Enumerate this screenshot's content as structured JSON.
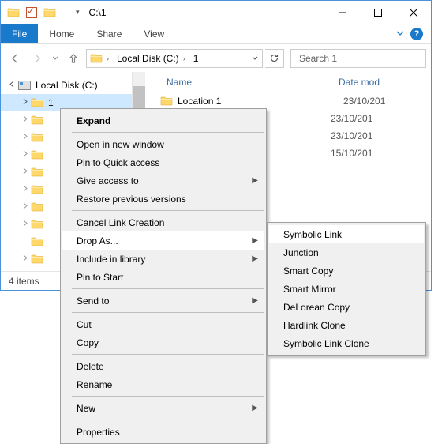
{
  "window": {
    "title": "C:\\1"
  },
  "ribbon": {
    "file": "File",
    "tabs": [
      "Home",
      "Share",
      "View"
    ]
  },
  "address": {
    "seg1": "Local Disk (C:)",
    "seg2": "1"
  },
  "search": {
    "placeholder": "Search 1"
  },
  "tree": {
    "root": "Local Disk (C:)",
    "items": [
      "1",
      "",
      "",
      "",
      "",
      "",
      "",
      "",
      "",
      ""
    ]
  },
  "columns": {
    "name": "Name",
    "date": "Date mod"
  },
  "files": [
    {
      "name": "Location 1",
      "date": "23/10/201"
    },
    {
      "name": "",
      "date": "23/10/201"
    },
    {
      "name": "",
      "date": "23/10/201"
    },
    {
      "name": "",
      "date": "15/10/201"
    }
  ],
  "status": "4 items",
  "context_main": {
    "expand": "Expand",
    "open_new": "Open in new window",
    "pin_qa": "Pin to Quick access",
    "give_access": "Give access to",
    "restore": "Restore previous versions",
    "cancel_link": "Cancel Link Creation",
    "drop_as": "Drop As...",
    "include_lib": "Include in library",
    "pin_start": "Pin to Start",
    "send_to": "Send to",
    "cut": "Cut",
    "copy": "Copy",
    "delete": "Delete",
    "rename": "Rename",
    "new": "New",
    "properties": "Properties"
  },
  "context_sub": {
    "symlink": "Symbolic Link",
    "junction": "Junction",
    "smart_copy": "Smart Copy",
    "smart_mirror": "Smart Mirror",
    "delorean": "DeLorean Copy",
    "hardlink": "Hardlink Clone",
    "symlink_clone": "Symbolic Link Clone"
  }
}
